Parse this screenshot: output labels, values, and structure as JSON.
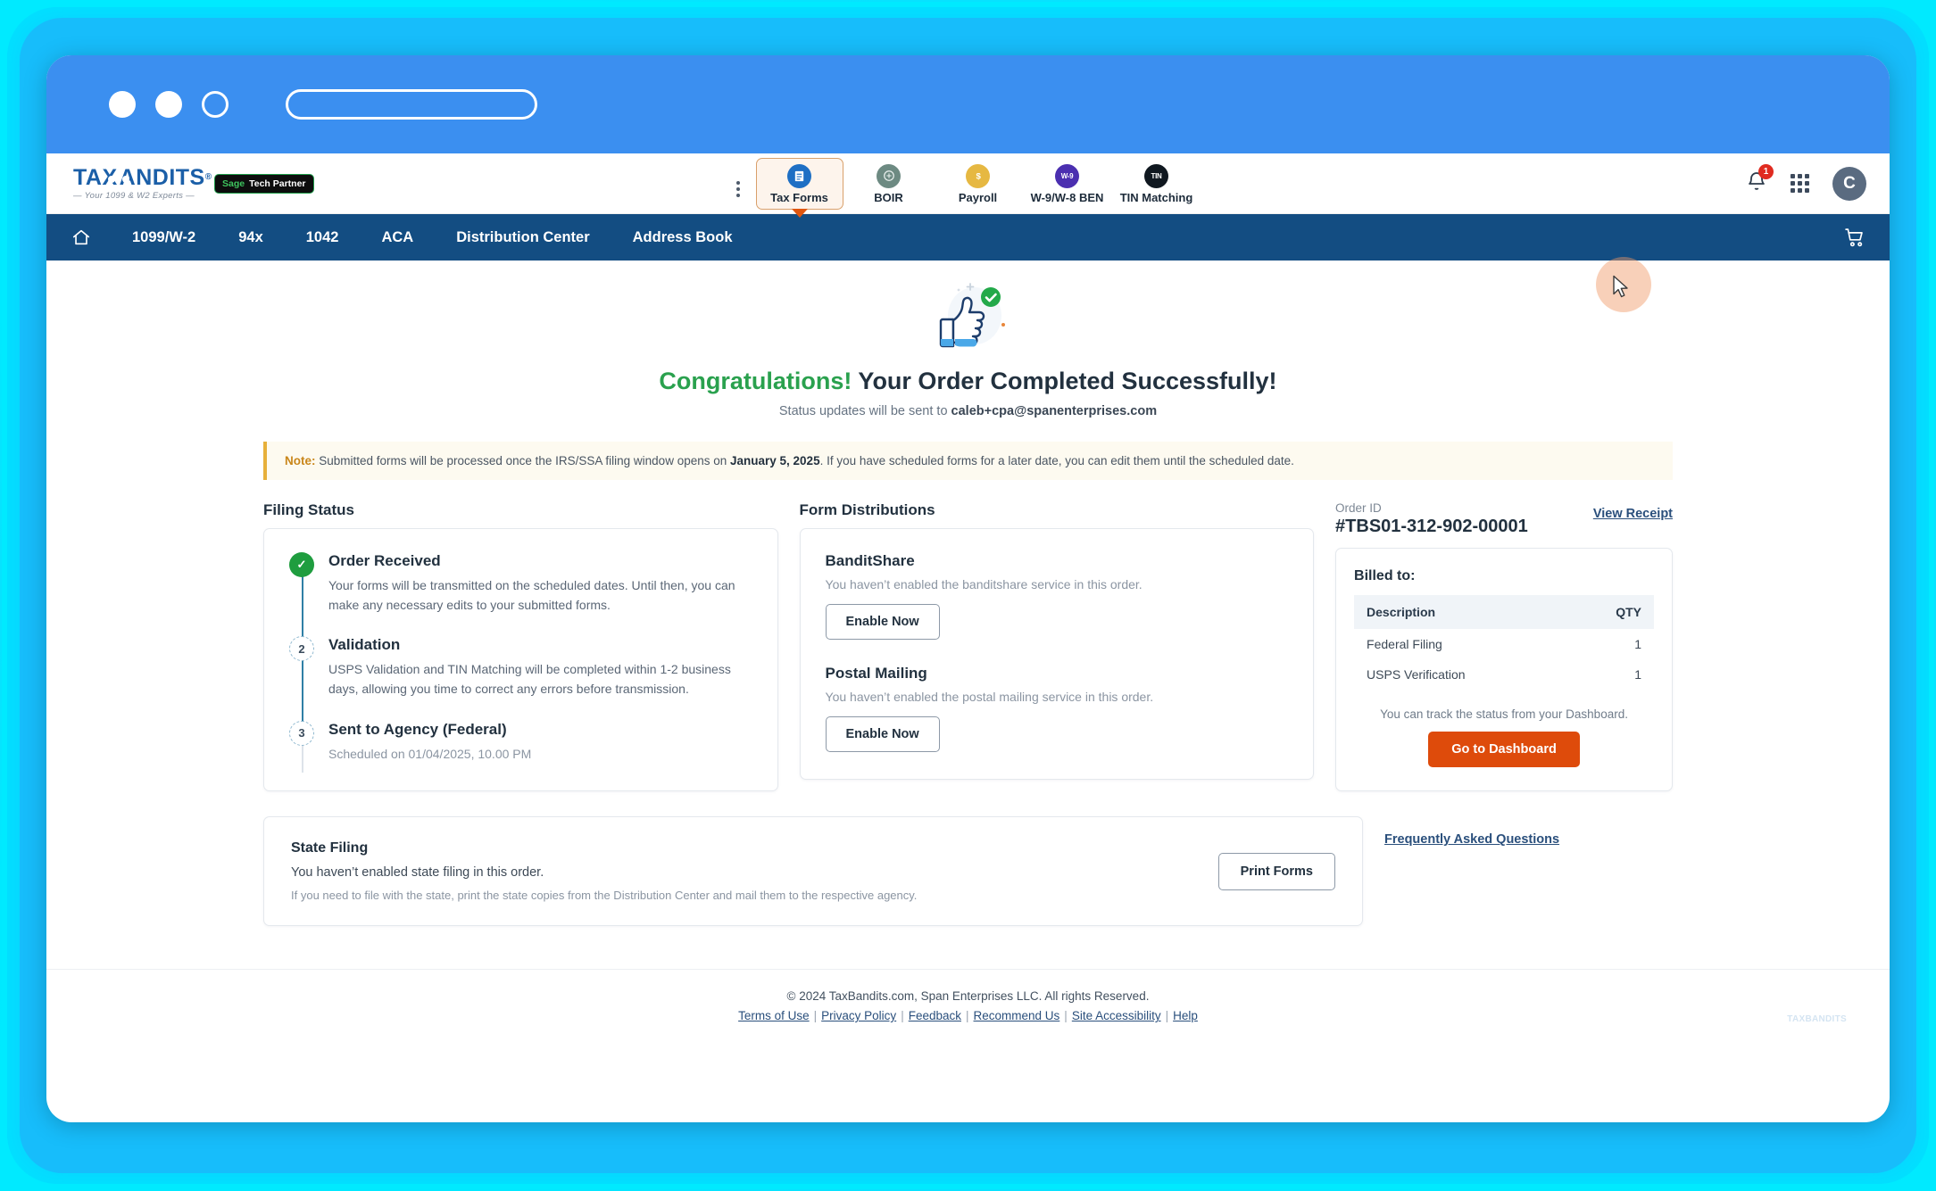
{
  "browser": {
    "dots": [
      "window-dot-1",
      "window-dot-2",
      "window-dot-3"
    ],
    "url_value": "",
    "url_placeholder": ""
  },
  "header": {
    "logo": {
      "word_left": "TAX",
      "word_right": "ANDITS",
      "registered": "®",
      "tagline": "— Your 1099 & W2 Experts —"
    },
    "partner_badge": {
      "brand": "Sage",
      "text": "Tech Partner"
    },
    "kebab_label": "more-options",
    "tabs": [
      {
        "label": "Tax Forms",
        "icon": "tax-forms-icon",
        "icon_text": "1099",
        "color": "#1e6fc4",
        "active": true
      },
      {
        "label": "BOIR",
        "icon": "boir-icon",
        "icon_text": "BOI",
        "color": "#6d8a82",
        "active": false
      },
      {
        "label": "Payroll",
        "icon": "payroll-icon",
        "icon_text": "$",
        "color": "#e6b842",
        "active": false
      },
      {
        "label": "W-9/W-8 BEN",
        "icon": "w9-w8ben-icon",
        "icon_text": "W-9",
        "color": "#4b2fb0",
        "active": false
      },
      {
        "label": "TIN Matching",
        "icon": "tin-matching-icon",
        "icon_text": "TIN",
        "color": "#101820",
        "active": false
      }
    ],
    "notification_count": "1",
    "avatar_initial": "C"
  },
  "nav": {
    "home_label": "Home",
    "items": [
      "1099/W-2",
      "94x",
      "1042",
      "ACA",
      "Distribution Center",
      "Address Book"
    ],
    "cart_label": "Cart"
  },
  "hero": {
    "congrats_word": "Congratulations!",
    "headline_rest": " Your Order Completed Successfully!",
    "status_prefix": "Status updates will be sent to ",
    "status_email": "caleb+cpa@spanenterprises.com"
  },
  "note": {
    "label": "Note:",
    "text_before": " Submitted forms will be processed once the IRS/SSA filing window opens on ",
    "date": "January 5, 2025",
    "text_after": ". If you have scheduled forms for a later date, you can edit them until the scheduled date."
  },
  "filing_status": {
    "heading": "Filing Status",
    "steps": [
      {
        "marker": "✓",
        "state": "done",
        "title": "Order Received",
        "desc": "Your forms will be transmitted on the scheduled dates. Until then, you can make any necessary edits to your submitted forms."
      },
      {
        "marker": "2",
        "state": "todo",
        "title": "Validation",
        "desc": "USPS Validation and TIN Matching will be completed within 1-2 business days, allowing you time to correct any errors before transmission."
      },
      {
        "marker": "3",
        "state": "todo",
        "title": "Sent to Agency (Federal)",
        "desc": "Scheduled on 01/04/2025, 10.00 PM"
      }
    ]
  },
  "form_distributions": {
    "heading": "Form Distributions",
    "blocks": [
      {
        "title": "BanditShare",
        "desc": "You haven’t enabled the banditshare service in this order.",
        "button": "Enable Now"
      },
      {
        "title": "Postal Mailing",
        "desc": "You haven’t enabled the postal mailing service in this order.",
        "button": "Enable Now"
      }
    ]
  },
  "order_panel": {
    "order_id_label": "Order ID",
    "order_id_value": "#TBS01-312-902-00001",
    "view_receipt": "View Receipt",
    "billed_to": "Billed to:",
    "table": {
      "columns": [
        "Description",
        "QTY"
      ],
      "rows": [
        {
          "description": "Federal Filing",
          "qty": "1"
        },
        {
          "description": "USPS Verification",
          "qty": "1"
        }
      ]
    },
    "track_note": "You can track the status from your Dashboard.",
    "dashboard_button": "Go to Dashboard"
  },
  "state_filing": {
    "title": "State Filing",
    "subtitle": "You haven’t enabled state filing in this order.",
    "hint": "If you need to file with the state, print the state copies from the Distribution Center and mail them to the respective agency.",
    "print_button": "Print Forms"
  },
  "faq_link": "Frequently Asked Questions",
  "footer": {
    "copyright": "© 2024 TaxBandits.com, Span Enterprises LLC. All rights Reserved.",
    "links": [
      "Terms of Use",
      "Privacy Policy",
      "Feedback",
      "Recommend Us",
      "Site Accessibility",
      "Help"
    ],
    "separator": "|",
    "watermark": "TAXBANDITS"
  },
  "colors": {
    "accent_orange": "#de4b0b",
    "nav_blue": "#134d82",
    "chrome_blue": "#3b8ff0",
    "frame_cyan": "#00eaff",
    "success_green": "#1f9d3f",
    "note_amber": "#e7b03a",
    "link_blue": "#2a4f7c"
  }
}
